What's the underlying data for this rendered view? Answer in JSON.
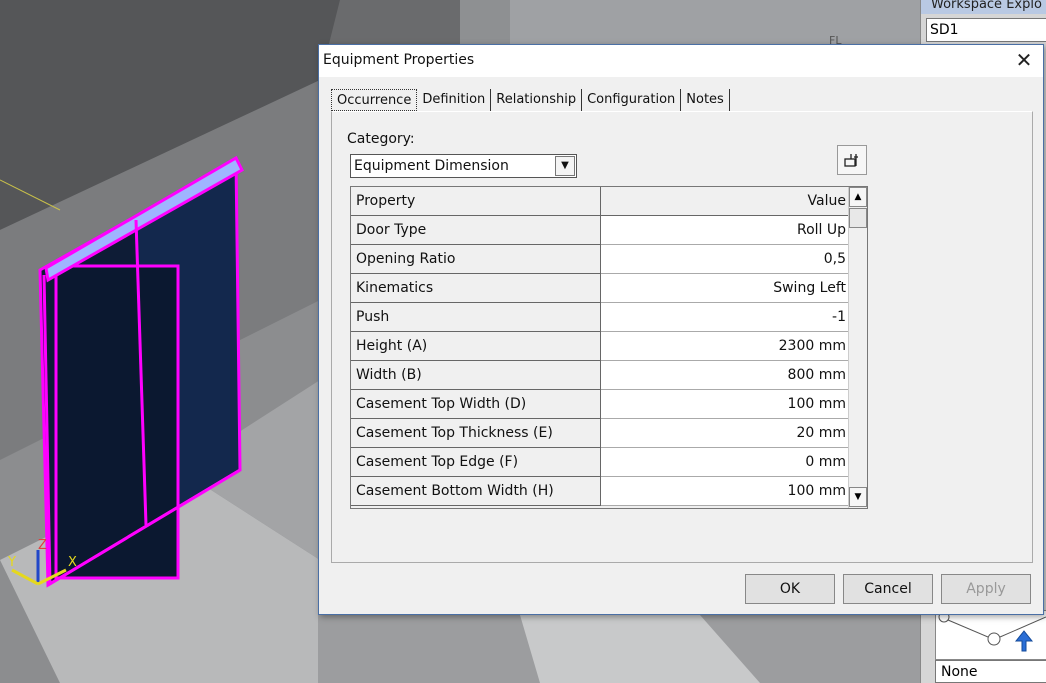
{
  "workspace": {
    "title": "Workspace Explo",
    "field_value": "SD1",
    "bottom_value": "None"
  },
  "viewport": {
    "axis_x": "X",
    "axis_y": "Y",
    "axis_z": "Z",
    "highlight_color": "#ff00ff",
    "label_fl": "FL"
  },
  "dialog": {
    "title": "Equipment Properties",
    "close_glyph": "✕",
    "tabs": [
      {
        "label": "Occurrence",
        "active": true
      },
      {
        "label": "Definition",
        "active": false
      },
      {
        "label": "Relationship",
        "active": false
      },
      {
        "label": "Configuration",
        "active": false
      },
      {
        "label": "Notes",
        "active": false
      }
    ],
    "category_label": "Category:",
    "category_value": "Equipment Dimension",
    "category_dropdown_glyph": "▼",
    "custom_button_icon": "properties-icon",
    "grid": {
      "header": {
        "name": "Property",
        "value": "Value"
      },
      "rows": [
        {
          "name": "Door Type",
          "value": "Roll Up"
        },
        {
          "name": "Opening Ratio",
          "value": "0,5"
        },
        {
          "name": "Kinematics",
          "value": "Swing Left"
        },
        {
          "name": "Push",
          "value": "-1"
        },
        {
          "name": "Height (A)",
          "value": "2300 mm"
        },
        {
          "name": "Width (B)",
          "value": "800 mm"
        },
        {
          "name": "Casement Top Width (D)",
          "value": "100 mm"
        },
        {
          "name": "Casement Top Thickness (E)",
          "value": "20 mm"
        },
        {
          "name": "Casement Top Edge (F)",
          "value": "0 mm"
        },
        {
          "name": "Casement Bottom Width (H)",
          "value": "100 mm"
        }
      ]
    },
    "buttons": {
      "ok": "OK",
      "cancel": "Cancel",
      "apply": "Apply"
    }
  }
}
